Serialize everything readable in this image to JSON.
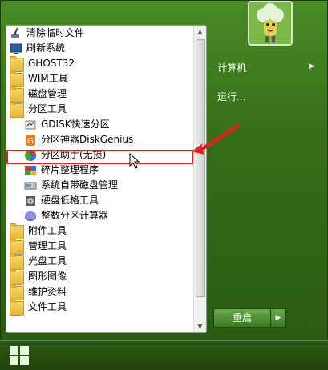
{
  "left_menu": {
    "items": [
      {
        "label": "清除临时文件",
        "icon": "broom-icon",
        "level": 0
      },
      {
        "label": "刷新系统",
        "icon": "monitor-icon",
        "level": 0
      },
      {
        "label": "GHOST32",
        "icon": "folder-icon",
        "level": 0
      },
      {
        "label": "WIM工具",
        "icon": "folder-icon",
        "level": 0
      },
      {
        "label": "磁盘管理",
        "icon": "folder-icon",
        "level": 0
      },
      {
        "label": "分区工具",
        "icon": "folder-icon",
        "level": 0
      },
      {
        "label": "GDISK快速分区",
        "icon": "disk-tool-icon",
        "level": 1
      },
      {
        "label": "分区神器DiskGenius",
        "icon": "diskgenius-icon",
        "level": 1
      },
      {
        "label": "分区助手(无损)",
        "icon": "partition-assistant-icon",
        "level": 1
      },
      {
        "label": "碎片整理程序",
        "icon": "defrag-icon",
        "level": 1
      },
      {
        "label": "系统自带磁盘管理",
        "icon": "disk-management-icon",
        "level": 1
      },
      {
        "label": "硬盘低格工具",
        "icon": "hdd-format-icon",
        "level": 1
      },
      {
        "label": "整数分区计算器",
        "icon": "calculator-icon",
        "level": 1
      },
      {
        "label": "附件工具",
        "icon": "folder-icon",
        "level": 0
      },
      {
        "label": "管理工具",
        "icon": "folder-icon",
        "level": 0
      },
      {
        "label": "光盘工具",
        "icon": "folder-icon",
        "level": 0
      },
      {
        "label": "图形图像",
        "icon": "folder-icon",
        "level": 0
      },
      {
        "label": "维护资料",
        "icon": "folder-icon",
        "level": 0
      },
      {
        "label": "文件工具",
        "icon": "folder-icon",
        "level": 0
      }
    ]
  },
  "right_menu": {
    "computer": "计算机",
    "run": "运行...",
    "restart": "重启"
  }
}
